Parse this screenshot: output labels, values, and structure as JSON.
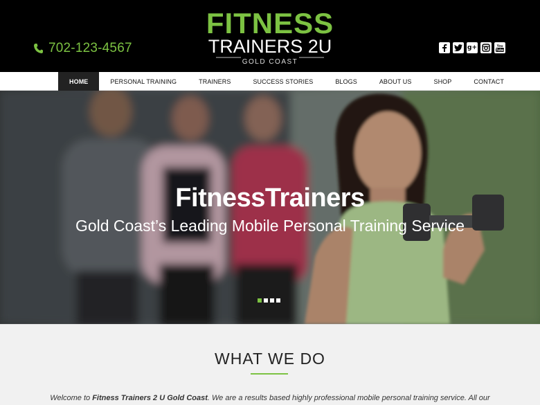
{
  "header": {
    "phone": "702-123-4567",
    "logo": {
      "line1": "FITNESS",
      "line2": "TRAINERS 2U",
      "line3": "GOLD COAST"
    },
    "social": [
      {
        "icon": "facebook-icon",
        "glyph": "f"
      },
      {
        "icon": "twitter-icon",
        "glyph": "t"
      },
      {
        "icon": "google-plus-icon",
        "glyph": "g+"
      },
      {
        "icon": "instagram-icon",
        "glyph": ""
      },
      {
        "icon": "youtube-icon",
        "glyph": "You Tube"
      }
    ]
  },
  "nav": {
    "items": [
      "HOME",
      "PERSONAL TRAINING",
      "TRAINERS",
      "SUCCESS STORIES",
      "BLOGS",
      "ABOUT US",
      "SHOP",
      "CONTACT"
    ],
    "active_index": 0
  },
  "hero": {
    "title": "FitnessTrainers",
    "subtitle": "Gold Coast’s Leading Mobile Personal Training Service",
    "slides_count": 4,
    "active_slide": 1
  },
  "content": {
    "heading": "WHAT WE DO",
    "intro_prefix": "Welcome to ",
    "intro_brand": "Fitness Trainers 2 U Gold Coast",
    "intro_suffix": ". We are a results based highly professional mobile personal training service. All our"
  },
  "colors": {
    "accent": "#7cc242",
    "header_bg": "#000000",
    "nav_active_bg": "#222222"
  }
}
